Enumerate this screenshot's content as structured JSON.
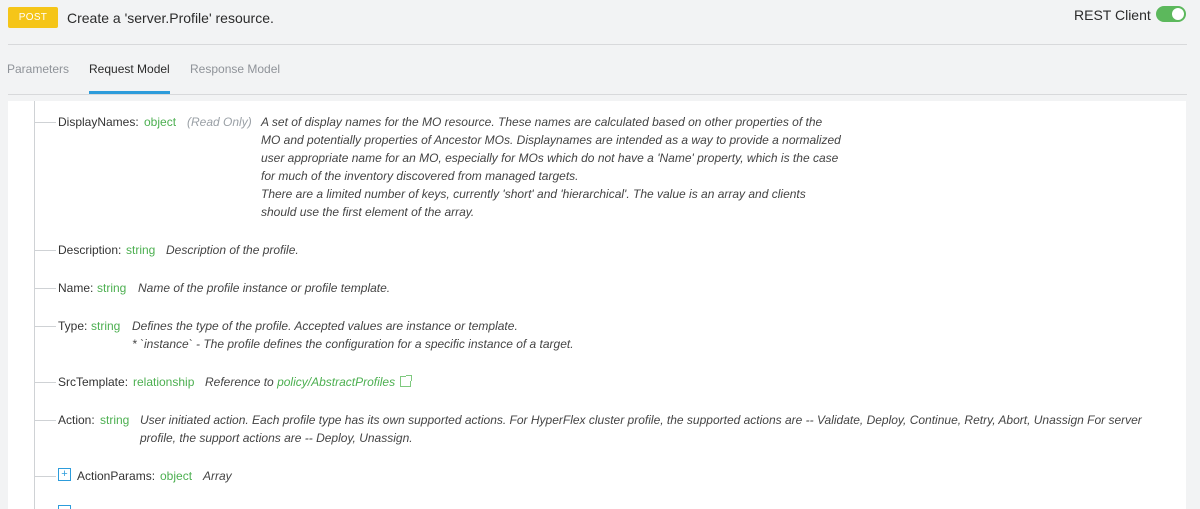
{
  "header": {
    "method": "POST",
    "title": "Create a 'server.Profile' resource.",
    "rest_client_label": "REST Client",
    "rest_client_enabled": true
  },
  "tabs": [
    {
      "label": "Parameters",
      "active": false
    },
    {
      "label": "Request Model",
      "active": true
    },
    {
      "label": "Response Model",
      "active": false
    }
  ],
  "properties": [
    {
      "name": "DisplayNames:",
      "type": "object",
      "read_only": "(Read Only)",
      "description": [
        "A set of display names for the MO resource. These names are calculated based on other properties of the",
        "MO and potentially properties of Ancestor MOs. Displaynames are intended as a way to provide a normalized",
        "user appropriate name for an MO, especially for MOs which do not have a 'Name' property, which is the case",
        "for much of the inventory discovered from managed targets.",
        "There are a limited number of keys, currently 'short' and 'hierarchical'. The value is an array and clients",
        "should use the first element of the array."
      ]
    },
    {
      "name": "Description:",
      "type": "string",
      "description": [
        "Description of the profile."
      ]
    },
    {
      "name": "Name:",
      "type": "string",
      "description": [
        "Name of the profile instance or profile template."
      ]
    },
    {
      "name": "Type:",
      "type": "string",
      "description": [
        "Defines the type of the profile. Accepted values are instance or template.",
        "* `instance` - The profile defines the configuration for a specific instance of a target."
      ]
    },
    {
      "name": "SrcTemplate:",
      "type": "relationship",
      "description_prefix": "Reference to",
      "link_text": "policy/AbstractProfiles"
    },
    {
      "name": "Action:",
      "type": "string",
      "description": [
        "User initiated action. Each profile type has its own supported actions. For HyperFlex cluster profile, the supported actions are -- Validate, Deploy, Continue, Retry, Abort, Unassign For server",
        "profile, the support actions are -- Deploy, Unassign."
      ]
    },
    {
      "expander": "+",
      "name": "ActionParams:",
      "type": "object",
      "description": [
        "Array"
      ]
    }
  ],
  "colors": {
    "badge": "#f5c518",
    "accent": "#2d9cdb",
    "type_green": "#4caf50",
    "toggle": "#5cb85c"
  }
}
